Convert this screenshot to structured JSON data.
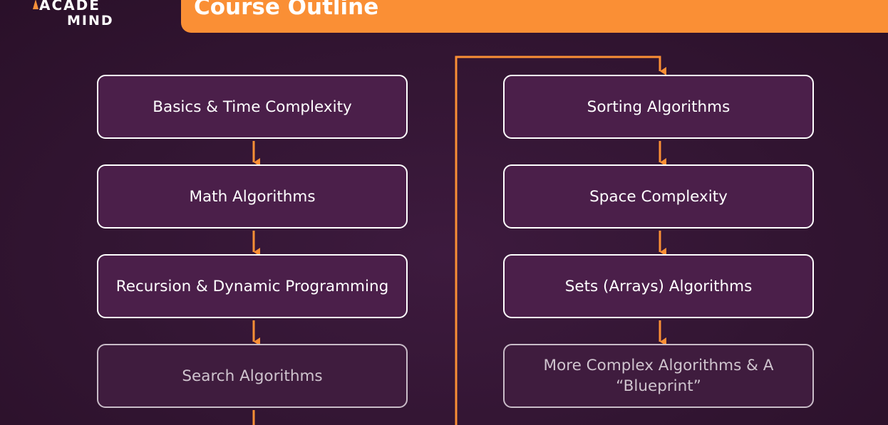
{
  "logo": {
    "line1": "ACADE",
    "line2": "MIND"
  },
  "header": {
    "title": "Course Outline"
  },
  "colors": {
    "accent": "#fa8f35",
    "background": "#321532",
    "box_fill": "#4b1f4a",
    "box_border": "#ffffff"
  },
  "outline": {
    "left_column": [
      "Basics & Time Complexity",
      "Math Algorithms",
      "Recursion & Dynamic Programming",
      "Search Algorithms"
    ],
    "right_column": [
      "Sorting Algorithms",
      "Space Complexity",
      "Sets (Arrays) Algorithms",
      "More Complex Algorithms & A “Blueprint”"
    ]
  }
}
